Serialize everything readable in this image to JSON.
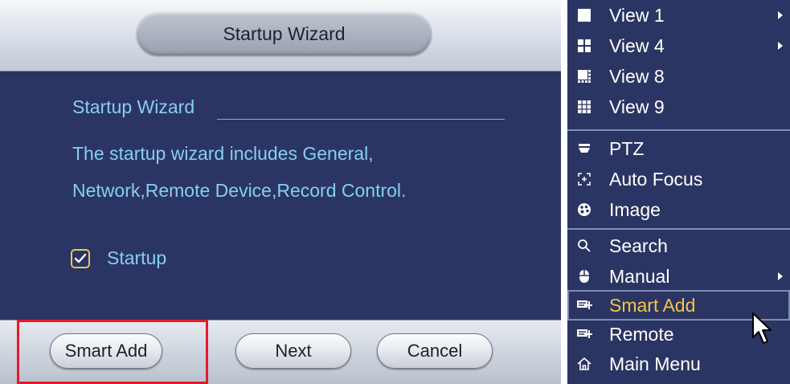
{
  "dialog": {
    "title": "Startup Wizard",
    "section_title": "Startup Wizard",
    "description_line1": "The startup wizard includes General,",
    "description_line2": "Network,Remote Device,Record Control.",
    "checkbox": {
      "label": "Startup",
      "checked": true
    },
    "buttons": {
      "smart_add": "Smart Add",
      "next": "Next",
      "cancel": "Cancel"
    }
  },
  "context_menu": {
    "groups": [
      [
        {
          "label": "View 1",
          "icon": "single-view-icon",
          "submenu": true
        },
        {
          "label": "View 4",
          "icon": "quad-view-icon",
          "submenu": true
        },
        {
          "label": "View 8",
          "icon": "eight-view-icon",
          "submenu": false
        },
        {
          "label": "View 9",
          "icon": "nine-view-icon",
          "submenu": false
        }
      ],
      [
        {
          "label": "PTZ",
          "icon": "ptz-icon",
          "submenu": false
        },
        {
          "label": "Auto Focus",
          "icon": "auto-focus-icon",
          "submenu": false
        },
        {
          "label": "Image",
          "icon": "image-palette-icon",
          "submenu": false
        }
      ],
      [
        {
          "label": "Search",
          "icon": "search-icon",
          "submenu": false
        },
        {
          "label": "Manual",
          "icon": "mouse-icon",
          "submenu": true
        },
        {
          "label": "Smart Add",
          "icon": "smart-add-icon",
          "submenu": false,
          "active": true
        },
        {
          "label": "Remote",
          "icon": "remote-device-icon",
          "submenu": false
        },
        {
          "label": "Main Menu",
          "icon": "home-icon",
          "submenu": false
        }
      ]
    ]
  },
  "colors": {
    "panel_bg": "#2b3563",
    "dialog_text": "#87cdf4",
    "menu_text": "#ffffff",
    "menu_active_text": "#f0c64a",
    "highlight_border": "#e8182a",
    "checkbox_border": "#e9c657"
  }
}
